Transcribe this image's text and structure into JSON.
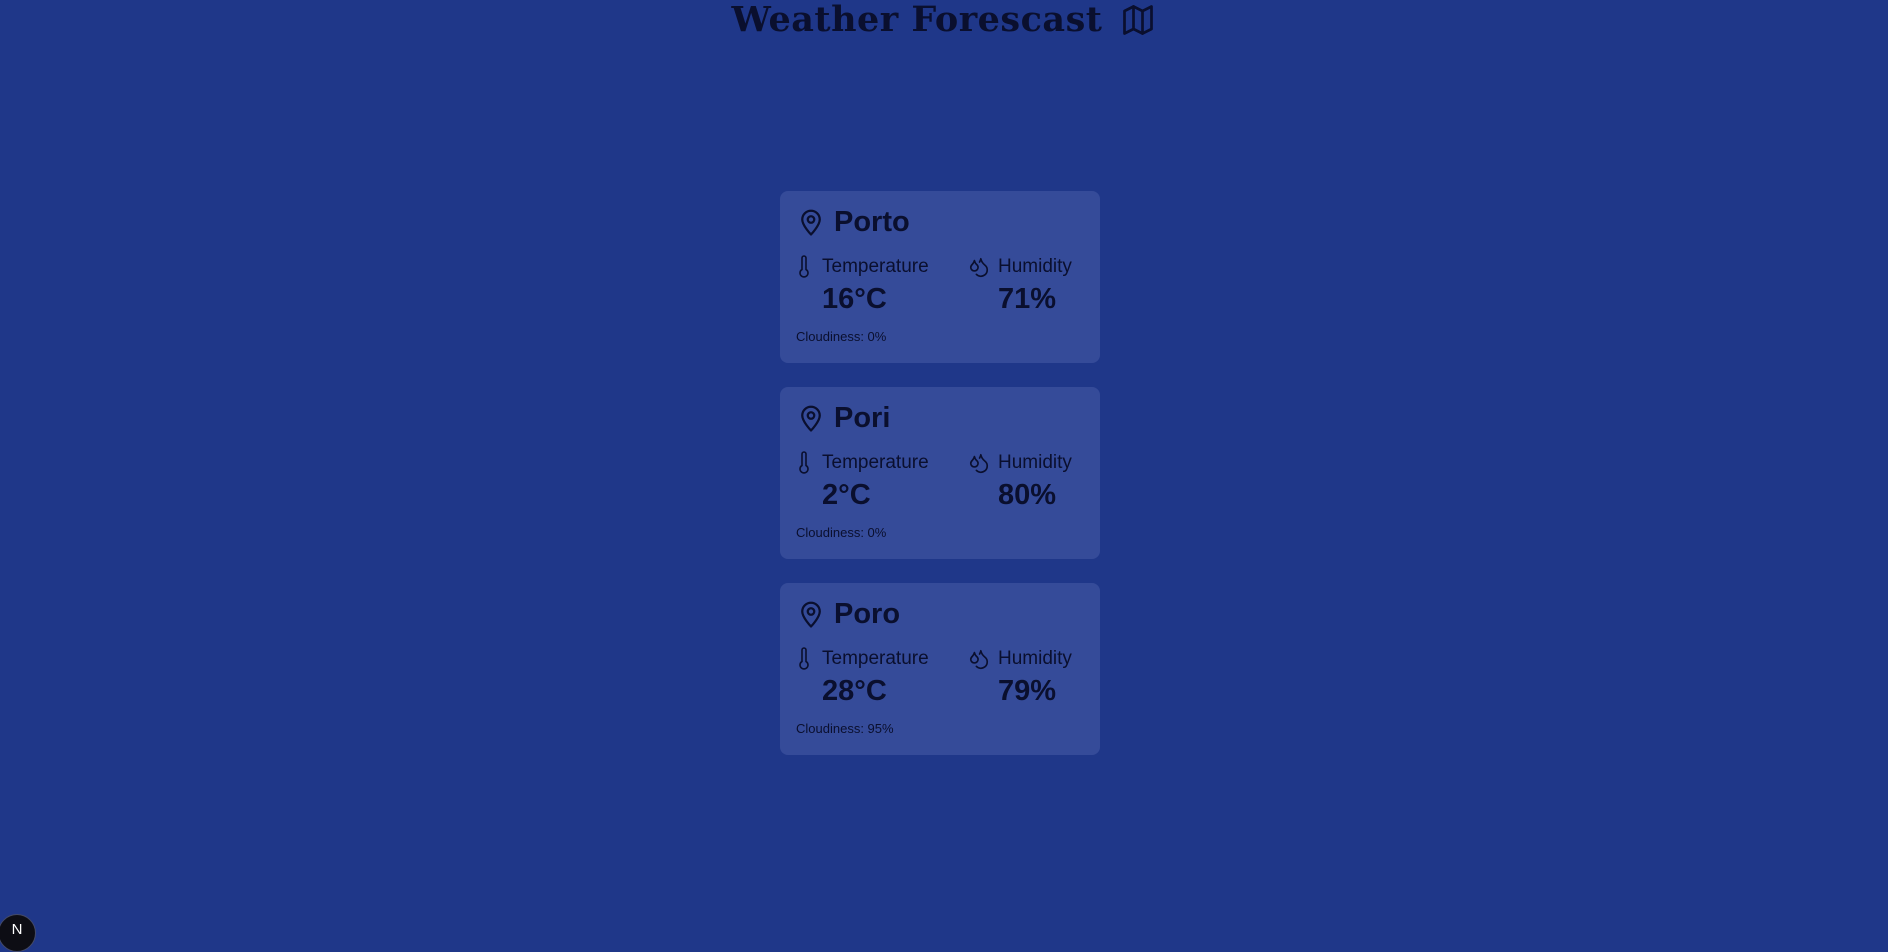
{
  "header": {
    "title": "Weather Forescast",
    "icon": "map-icon"
  },
  "cards": [
    {
      "city": "Porto",
      "temperature_label": "Temperature",
      "temperature_value": "16°C",
      "humidity_label": "Humidity",
      "humidity_value": "71%",
      "cloudiness": "Cloudiness: 0%"
    },
    {
      "city": "Pori",
      "temperature_label": "Temperature",
      "temperature_value": "2°C",
      "humidity_label": "Humidity",
      "humidity_value": "80%",
      "cloudiness": "Cloudiness: 0%"
    },
    {
      "city": "Poro",
      "temperature_label": "Temperature",
      "temperature_value": "28°C",
      "humidity_label": "Humidity",
      "humidity_value": "79%",
      "cloudiness": "Cloudiness: 95%"
    }
  ],
  "badge": {
    "label": "N"
  },
  "colors": {
    "background": "#1f3789",
    "card": "#354b99",
    "text": "#0a0f2e"
  }
}
